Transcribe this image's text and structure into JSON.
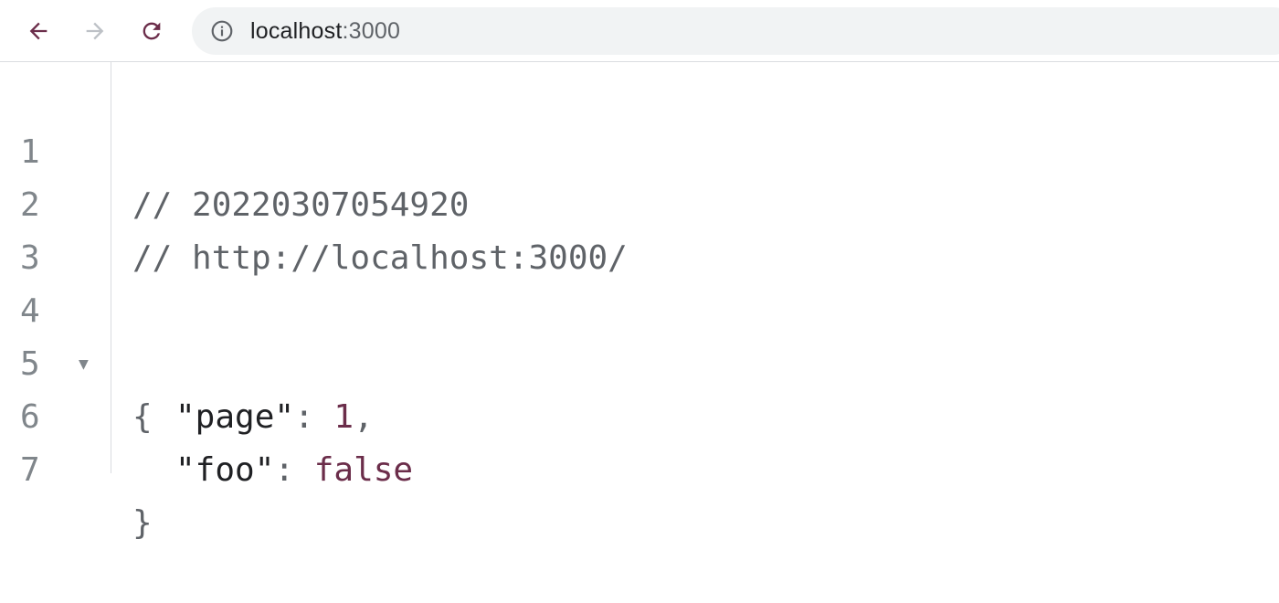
{
  "browser": {
    "address": {
      "host": "localhost",
      "port": ":3000"
    }
  },
  "viewer": {
    "lines": [
      {
        "n": "1",
        "text": "// 20220307054920"
      },
      {
        "n": "2",
        "text": "// http://localhost:3000/"
      },
      {
        "n": "3",
        "text": ""
      },
      {
        "n": "4",
        "text": "{"
      },
      {
        "n": "5",
        "key": "\"page\"",
        "sep": ": ",
        "value": "1",
        "trail": ","
      },
      {
        "n": "6",
        "key": "\"foo\"",
        "sep": ": ",
        "value": "false",
        "trail": ""
      },
      {
        "n": "7",
        "text": "}"
      }
    ]
  },
  "colors": {
    "value": "#6b2d4a",
    "comment": "#5f6368",
    "line_number": "#80868b"
  }
}
